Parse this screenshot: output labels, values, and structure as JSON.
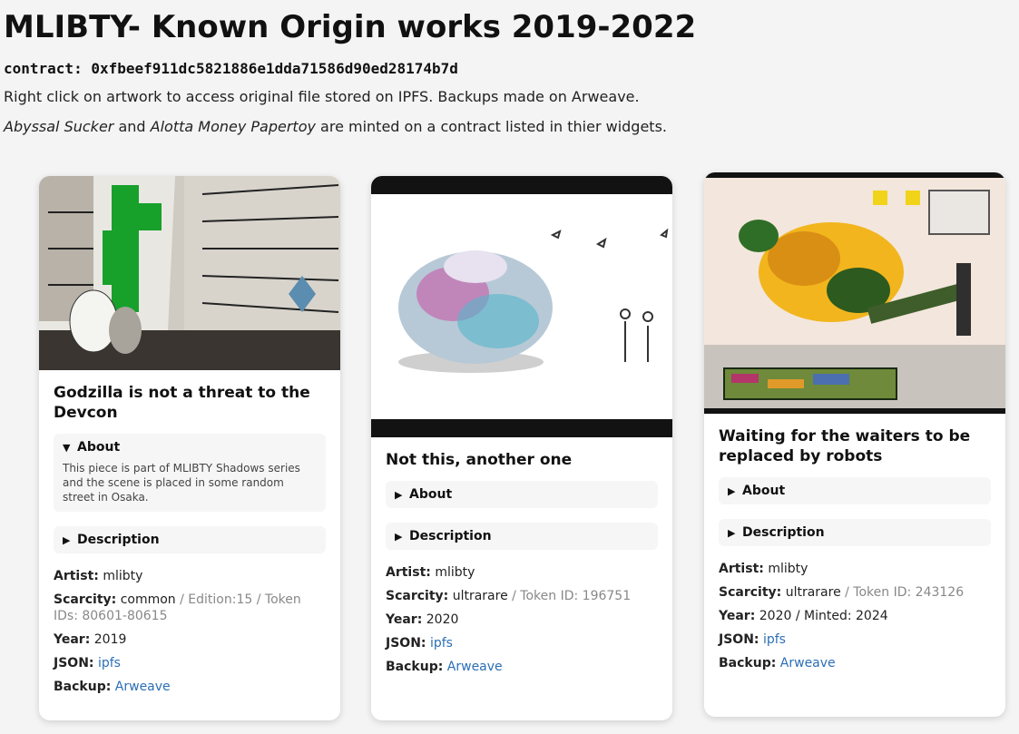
{
  "header": {
    "title": "MLIBTY- Known Origin works 2019-2022",
    "contract_label": "contract:",
    "contract_value": "0xfbeef911dc5821886e1dda71586d90ed28174b7d",
    "line1": "Right click on artwork to access original file stored on IPFS. Backups made on Arweave.",
    "line2_em1": "Abyssal Sucker",
    "line2_mid": " and ",
    "line2_em2": "Alotta Money Papertoy",
    "line2_end": " are minted on a contract listed in thier widgets."
  },
  "labels": {
    "about": "About",
    "description": "Description",
    "artist": "Artist:",
    "scarcity": "Scarcity:",
    "year": "Year:",
    "json": "JSON:",
    "backup": "Backup:"
  },
  "cards": [
    {
      "title": "Godzilla is not a threat to the Devcon",
      "about_text": "This piece is part of MLIBTY Shadows series and the scene is placed in some random street in Osaka.",
      "artist": "mlibty",
      "scarcity": "common",
      "scarcity_extra": " / Edition:15 / Token IDs: 80601-80615",
      "year": "2019",
      "json": "ipfs",
      "backup": "Arweave"
    },
    {
      "title": "Not this, another one",
      "artist": "mlibty",
      "scarcity": "ultrarare",
      "scarcity_extra": " / Token ID: 196751",
      "year": "2020",
      "json": "ipfs",
      "backup": "Arweave"
    },
    {
      "title": "Waiting for the waiters to be replaced by robots",
      "artist": "mlibty",
      "scarcity": "ultrarare",
      "scarcity_extra": " / Token ID: 243126",
      "year": "2020 / Minted: 2024",
      "json": "ipfs",
      "backup": "Arweave"
    }
  ]
}
